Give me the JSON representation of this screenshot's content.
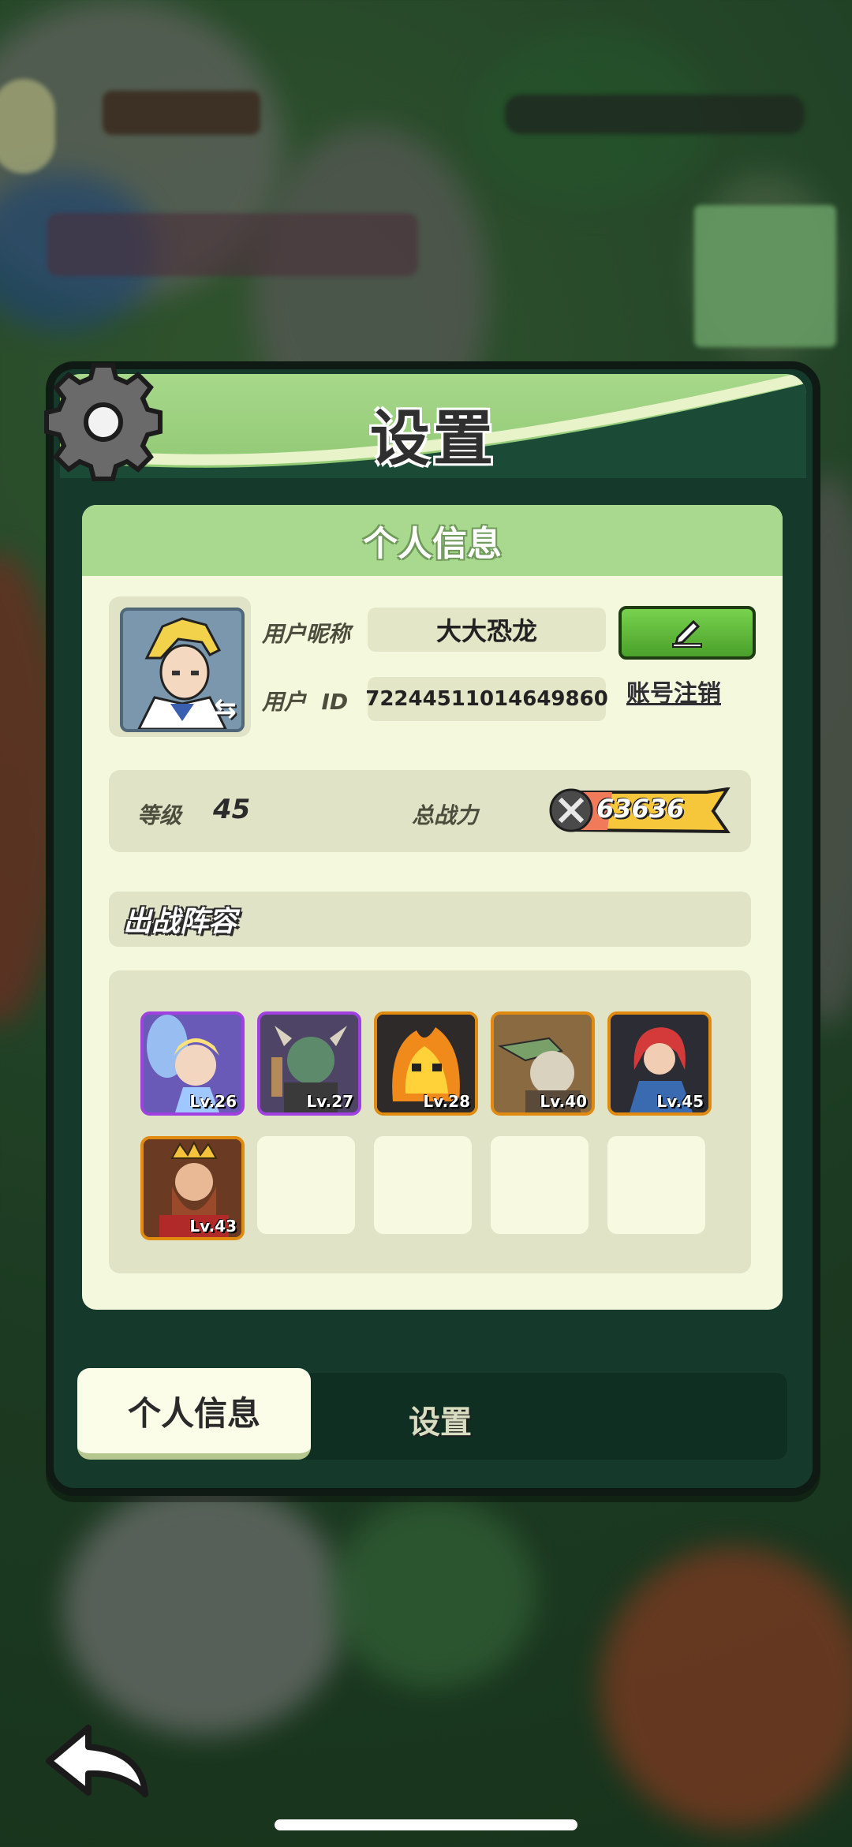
{
  "panel": {
    "title": "设置"
  },
  "profile": {
    "section_title": "个人信息",
    "nickname_label": "用户昵称",
    "nickname_value": "大大恐龙",
    "id_label": "用户  ID",
    "id_value": "72244511014649860",
    "cancel_account_label": "账号注销",
    "level_label": "等级",
    "level_value": "45",
    "power_label": "总战力",
    "power_value": "63636"
  },
  "lineup": {
    "title": "出战阵容",
    "heroes": [
      {
        "level": "Lv.26",
        "rarity_color": "#a040e0"
      },
      {
        "level": "Lv.27",
        "rarity_color": "#a040e0"
      },
      {
        "level": "Lv.28",
        "rarity_color": "#e08a10"
      },
      {
        "level": "Lv.40",
        "rarity_color": "#e08a10"
      },
      {
        "level": "Lv.45",
        "rarity_color": "#e08a10"
      },
      {
        "level": "Lv.43",
        "rarity_color": "#e08a10"
      }
    ],
    "empty_slots": 4
  },
  "tabs": {
    "active": "个人信息",
    "inactive": "设置"
  },
  "colors": {
    "header_green": "#a7d88a",
    "card_bg": "#f4f8dc",
    "edit_button_green": "#5ab836",
    "epic_purple": "#a040e0",
    "legend_orange": "#e08a10"
  }
}
